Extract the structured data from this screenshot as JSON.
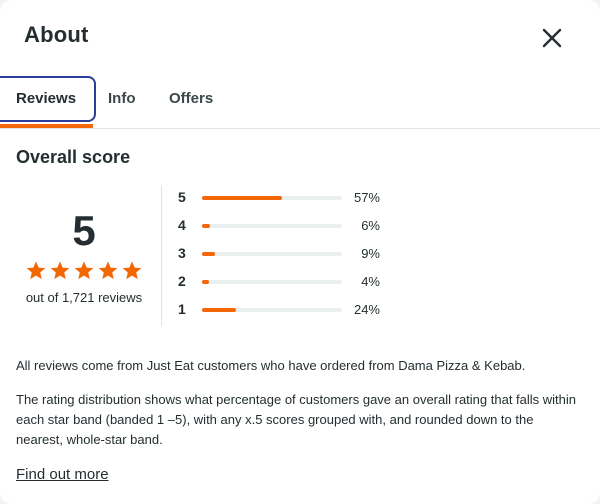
{
  "dialog": {
    "title": "About",
    "close_icon": "close-icon"
  },
  "tabs": [
    {
      "label": "Reviews",
      "active": true
    },
    {
      "label": "Info",
      "active": false
    },
    {
      "label": "Offers",
      "active": false
    }
  ],
  "overall": {
    "section_title": "Overall score",
    "score": "5",
    "stars": 5,
    "reviews_count": "out of 1,721 reviews",
    "distribution": [
      {
        "label": "5",
        "percent": 57,
        "percent_text": "57%"
      },
      {
        "label": "4",
        "percent": 6,
        "percent_text": "6%"
      },
      {
        "label": "3",
        "percent": 9,
        "percent_text": "9%"
      },
      {
        "label": "2",
        "percent": 4,
        "percent_text": "4%"
      },
      {
        "label": "1",
        "percent": 24,
        "percent_text": "24%"
      }
    ]
  },
  "info": {
    "para1": "All reviews come from Just Eat customers who have ordered from Dama Pizza & Kebab.",
    "para2": "The rating distribution shows what percentage of customers gave an overall rating that falls within each star band (banded 1 –5), with any x.5 scores grouped with, and rounded down to the nearest, whole-star band.",
    "find_more": "Find out more"
  },
  "colors": {
    "accent": "#f36805",
    "focus": "#2c3d9a",
    "text": "#242e30"
  }
}
